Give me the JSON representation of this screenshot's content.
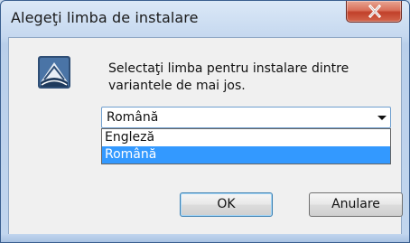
{
  "window": {
    "title": "Alegeţi limba de instalare",
    "close_icon": "close-icon"
  },
  "dialog": {
    "icon": "installer-app-icon",
    "prompt": "Selectaţi limba pentru instalare dintre variantele de mai jos."
  },
  "language_select": {
    "value": "Română",
    "arrow_icon": "chevron-down-icon",
    "options": [
      "Engleză",
      "Română"
    ],
    "highlighted_index": 1
  },
  "buttons": {
    "ok_label": "OK",
    "cancel_label": "Anulare"
  },
  "colors": {
    "selection": "#3399ff",
    "close_button": "#c1402a",
    "title_bar": "#c5d8ef"
  }
}
